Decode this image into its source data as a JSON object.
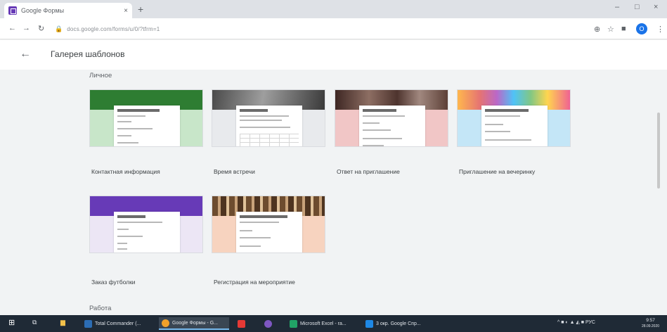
{
  "browser": {
    "tab_title": "Google Формы",
    "tab_close": "×",
    "new_tab": "+",
    "url": "docs.google.com/forms/u/0/?tfrm=1",
    "minimize": "–",
    "maximize": "□",
    "close": "×",
    "profile_initial": "О"
  },
  "header": {
    "back_glyph": "←",
    "title": "Галерея шаблонов"
  },
  "sections": [
    {
      "label": "Личное",
      "templates": [
        {
          "name": "Контактная информация",
          "banner": "#2e7d32",
          "body": "#c8e6c9"
        },
        {
          "name": "Время встречи",
          "banner": "#5f5f5f",
          "body": "#e8eaed"
        },
        {
          "name": "Ответ на приглашение",
          "banner": "#5d4037",
          "body": "#f1c6c6"
        },
        {
          "name": "Приглашение на вечеринку",
          "banner": "#ffb74d",
          "body": "#c4e6f7"
        },
        {
          "name": "Заказ футболки",
          "banner": "#673ab7",
          "body": "#ece6f5"
        },
        {
          "name": "Регистрация на мероприятие",
          "banner": "#6d4c2f",
          "body": "#f7d3bf"
        }
      ]
    },
    {
      "label": "Работа"
    }
  ],
  "taskbar": {
    "items": [
      {
        "label": "Total Commander (...",
        "color": "#2c6db4"
      },
      {
        "label": "Google Формы - G...",
        "color": "#f0a12b"
      },
      {
        "label": "",
        "color": "#e53935"
      },
      {
        "label": "",
        "color": "#7e57c2"
      },
      {
        "label": "Microsoft Excel - ra...",
        "color": "#21a366"
      },
      {
        "label": "3 окр. Google Спр...",
        "color": "#1e88e5"
      }
    ],
    "tray": "^ ■ ◐ ▲ ◭ ■ РУС",
    "time": "9:57",
    "date": "28.09.2020"
  }
}
